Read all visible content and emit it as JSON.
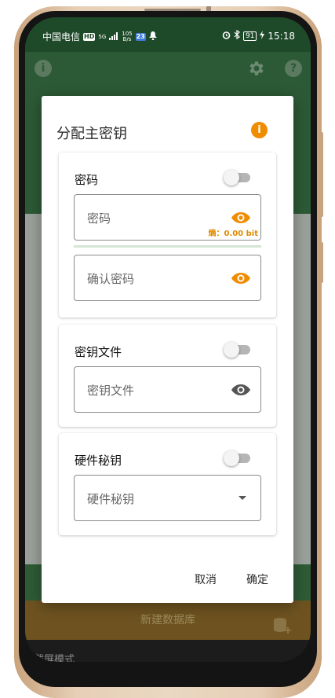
{
  "status_bar": {
    "carrier": "中国电信",
    "hd_badge": "HD",
    "network": "5G",
    "speed_value": "105",
    "speed_unit": "B/s",
    "notification_badge": "23",
    "battery": "91",
    "time": "15:18"
  },
  "dialog": {
    "title": "分配主密钥",
    "password_card": {
      "label": "密码",
      "password_placeholder": "密码",
      "entropy": "熵：0.00 bit",
      "confirm_placeholder": "确认密码"
    },
    "keyfile_card": {
      "label": "密钥文件",
      "placeholder": "密钥文件"
    },
    "hardware_card": {
      "label": "硬件秘钥",
      "placeholder": "硬件秘钥"
    },
    "cancel": "取消",
    "confirm": "确定"
  },
  "background": {
    "new_database": "新建数据库",
    "screen_mode": "截屏模式"
  },
  "colors": {
    "accent_orange": "#f08c00",
    "app_green": "#2c5a36"
  },
  "icons": [
    "info-icon",
    "gear-icon",
    "help-icon",
    "eye-icon",
    "dropdown-arrow-icon",
    "database-add-icon"
  ]
}
